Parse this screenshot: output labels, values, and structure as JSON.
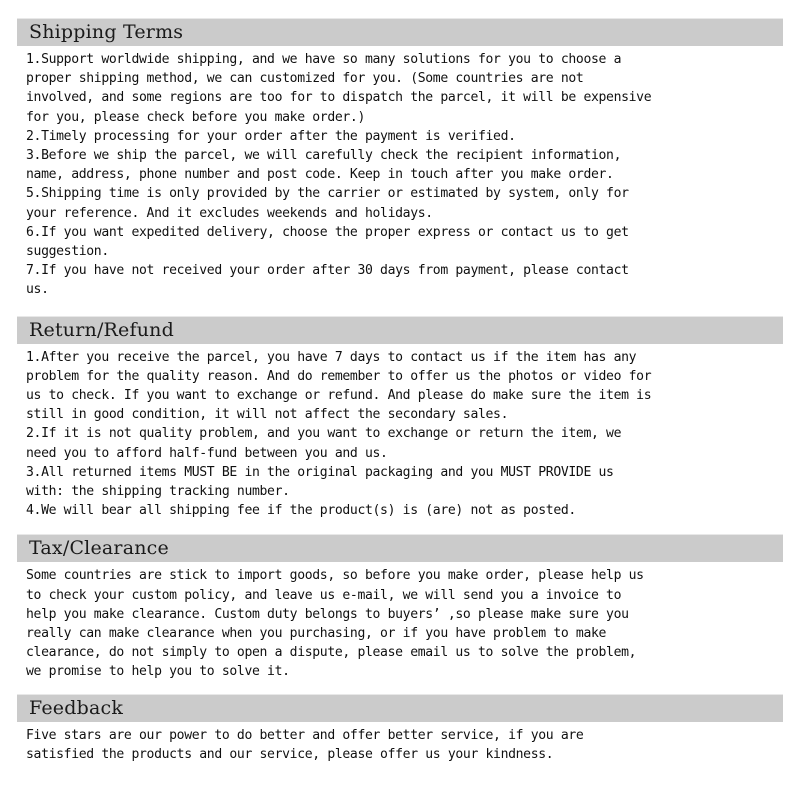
{
  "document": {
    "type": "store-policy-terms",
    "accent_bar_color": "#cbcbcb",
    "text_color": "#101010",
    "background_color": "#ffffff"
  },
  "sections": [
    {
      "id": "shipping-terms",
      "title": "Shipping Terms",
      "lines": [
        "1.Support worldwide shipping, and we have so many solutions for you to choose a",
        "proper shipping method, we can customized for you. (Some countries are not",
        "involved, and some regions are too for to dispatch the parcel, it will be expensive",
        "for you, please check before you make order.)",
        "2.Timely processing for your order after the payment is verified.",
        "3.Before we ship the parcel, we will carefully check the recipient information,",
        "name, address, phone number and post code. Keep in touch after you make order.",
        "5.Shipping time is only provided by the carrier or estimated by system, only for",
        "your reference. And it excludes weekends and holidays.",
        "6.If you want expedited delivery, choose the proper express or contact us to get",
        "suggestion.",
        "7.If you have not received your order after 30 days from payment, please contact",
        "us."
      ]
    },
    {
      "id": "return-refund",
      "title": "Return/Refund",
      "lines": [
        "1.After you receive the parcel, you have 7 days to contact us if the item has any",
        "problem for the quality reason. And do remember to offer us the photos or video for",
        "us to check. If you want to exchange or refund. And please do make sure the item is",
        "still in good condition, it will not affect the secondary sales.",
        "2.If it is not quality problem, and you want to exchange or return the item, we",
        "need you to afford half-fund between you and us.",
        "3.All returned items MUST BE in the original packaging and you MUST PROVIDE us",
        "with: the shipping tracking number.",
        "4.We will bear all shipping fee if the product(s) is (are) not as posted."
      ]
    },
    {
      "id": "tax-clearance",
      "title": "Tax/Clearance",
      "lines": [
        "Some countries are stick to import goods, so before you make order, please help us",
        "to check your custom policy, and leave us e-mail, we will send you a invoice to",
        "help you make clearance. Custom duty belongs to buyers’ ,so please make sure you",
        "really can make clearance when you purchasing, or if you have problem to make",
        "clearance, do not simply to open a dispute, please email us to solve the problem,",
        "we promise to help you to solve it."
      ]
    },
    {
      "id": "feedback",
      "title": "Feedback",
      "lines": [
        "Five stars are our power to do better and offer better service, if you are",
        "satisfied the products and our service, please offer us your kindness."
      ]
    }
  ]
}
